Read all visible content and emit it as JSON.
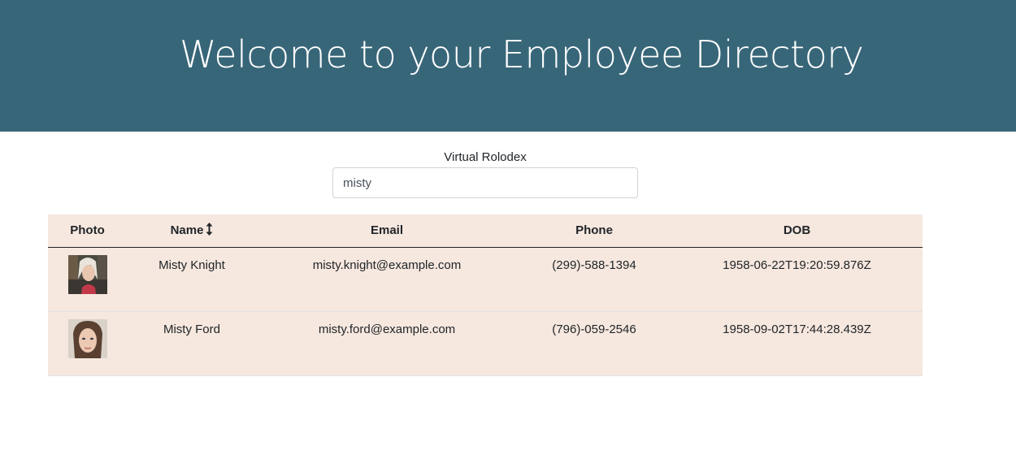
{
  "header": {
    "title": "Welcome to your Employee Directory"
  },
  "search": {
    "label": "Virtual Rolodex",
    "value": "misty",
    "placeholder": ""
  },
  "table": {
    "columns": {
      "photo": "Photo",
      "name": "Name",
      "email": "Email",
      "phone": "Phone",
      "dob": "DOB"
    },
    "sort_icon": "sort-vertical-arrows-icon",
    "rows": [
      {
        "name": "Misty Knight",
        "email": "misty.knight@example.com",
        "phone": "(299)-588-1394",
        "dob": "1958-06-22T19:20:59.876Z"
      },
      {
        "name": "Misty Ford",
        "email": "misty.ford@example.com",
        "phone": "(796)-059-2546",
        "dob": "1958-09-02T17:44:28.439Z"
      }
    ]
  },
  "colors": {
    "header_bg": "#386679",
    "table_bg": "#f6e8df"
  }
}
